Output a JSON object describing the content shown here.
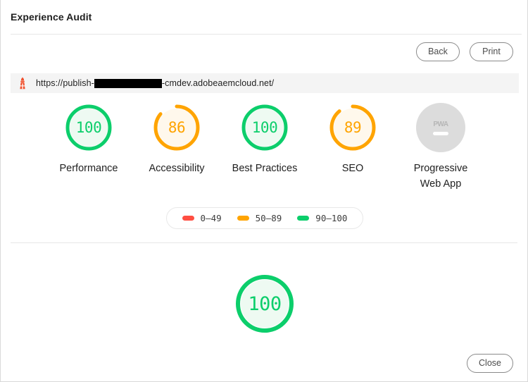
{
  "window": {
    "title": "Experience Audit"
  },
  "toolbar": {
    "back_label": "Back",
    "print_label": "Print"
  },
  "urlbar": {
    "icon": "lighthouse-icon",
    "prefix": "https://publish-",
    "redacted": "",
    "suffix": "-cmdev.adobeaemcloud.net/"
  },
  "chart_data": {
    "type": "gauge",
    "title": "Lighthouse category scores",
    "categories": [
      "Performance",
      "Accessibility",
      "Best Practices",
      "SEO",
      "Progressive Web App"
    ],
    "values": [
      100,
      86,
      100,
      89,
      null
    ],
    "ylim": [
      0,
      100
    ],
    "legend_position": "below",
    "scores": [
      {
        "label": "Performance",
        "value": "100",
        "score": 100,
        "color": "#0cce6b",
        "fill": "#eefaf2",
        "state": "pass"
      },
      {
        "label": "Accessibility",
        "value": "86",
        "score": 86,
        "color": "#ffa400",
        "fill": "#fff8ec",
        "state": "average"
      },
      {
        "label": "Best Practices",
        "value": "100",
        "score": 100,
        "color": "#0cce6b",
        "fill": "#eefaf2",
        "state": "pass"
      },
      {
        "label": "SEO",
        "value": "89",
        "score": 89,
        "color": "#ffa400",
        "fill": "#fff8ec",
        "state": "average"
      },
      {
        "label": "Progressive\nWeb App",
        "label_line1": "Progressive",
        "label_line2": "Web App",
        "value": "PWA",
        "score": null,
        "color": "#dcdcdc",
        "fill": "#dcdcdc",
        "state": "not-applicable"
      }
    ],
    "legend": [
      {
        "range": "0–49",
        "color": "#ff4e42"
      },
      {
        "range": "50–89",
        "color": "#ffa400"
      },
      {
        "range": "90–100",
        "color": "#0cce6b"
      }
    ],
    "overall": {
      "value": "100",
      "score": 100,
      "color": "#0cce6b",
      "fill": "#eefaf2"
    }
  },
  "footer": {
    "close_label": "Close"
  },
  "colors": {
    "pass": "#0cce6b",
    "average": "#ffa400",
    "fail": "#ff4e42",
    "na": "#dcdcdc",
    "lighthouse": "#f0502d"
  }
}
